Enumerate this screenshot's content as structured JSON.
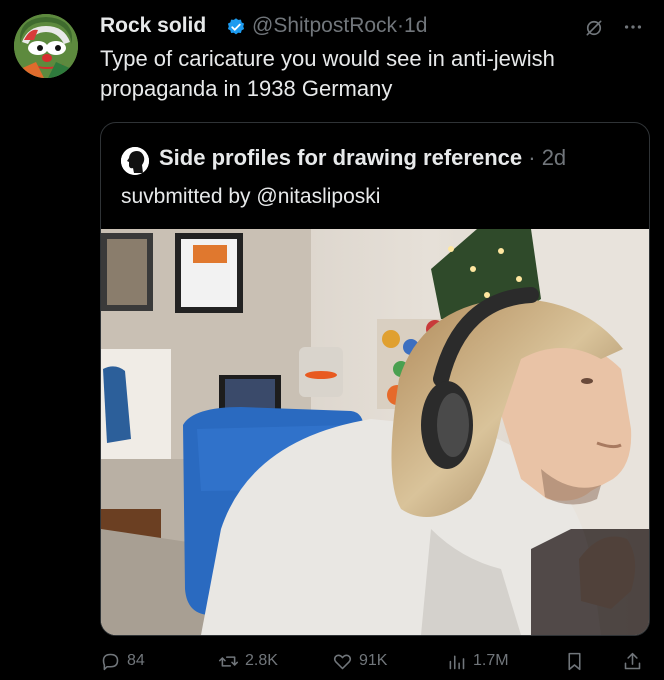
{
  "tweet": {
    "display_name": "Rock solid",
    "handle": "@ShitpostRock",
    "separator": "·",
    "time": "1d",
    "text": "Type of caricature you would see in anti-jewish\npropaganda in 1938 Germany",
    "icons": {
      "verified": "verified-badge-icon",
      "grok": "grok-icon",
      "more": "more-icon"
    }
  },
  "quote": {
    "title": "Side profiles for drawing reference",
    "separator": "·",
    "time": "2d",
    "subtitle": "suvbmitted by @nitasliposki"
  },
  "actions": {
    "replies": "84",
    "reposts": "2.8K",
    "likes": "91K",
    "views": "1.7M"
  },
  "colors": {
    "background": "#000000",
    "text": "#e7e9ea",
    "muted": "#71767b",
    "verified": "#1d9bf0",
    "border": "#2f3336"
  }
}
